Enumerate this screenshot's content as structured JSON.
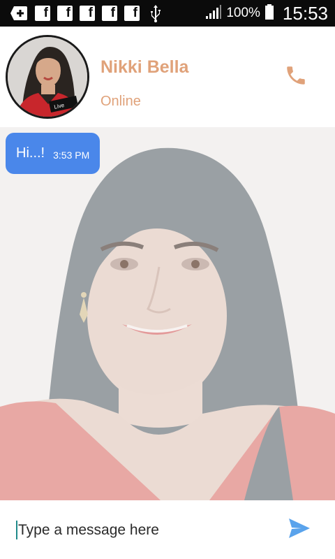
{
  "status_bar": {
    "icons": [
      "add-box-icon",
      "facebook-icon",
      "facebook-icon",
      "facebook-icon",
      "facebook-icon",
      "facebook-icon",
      "usb-icon",
      "signal-icon",
      "battery-icon"
    ],
    "facebook_letter": "f",
    "battery_percent": "100%",
    "time": "15:53"
  },
  "header": {
    "contact_name": "Nikki Bella",
    "contact_status": "Online",
    "call_icon": "phone-icon",
    "avatar_badge": "Live"
  },
  "chat": {
    "messages": [
      {
        "text": "Hi...!",
        "time": "3:53 PM"
      }
    ]
  },
  "composer": {
    "placeholder": "Type a message here",
    "value": "",
    "send_icon": "send-icon"
  },
  "colors": {
    "accent": "#e0a27a",
    "bubble": "#4a87ea",
    "send": "#5aa3ec",
    "status_bar": "#0b0b0b"
  }
}
